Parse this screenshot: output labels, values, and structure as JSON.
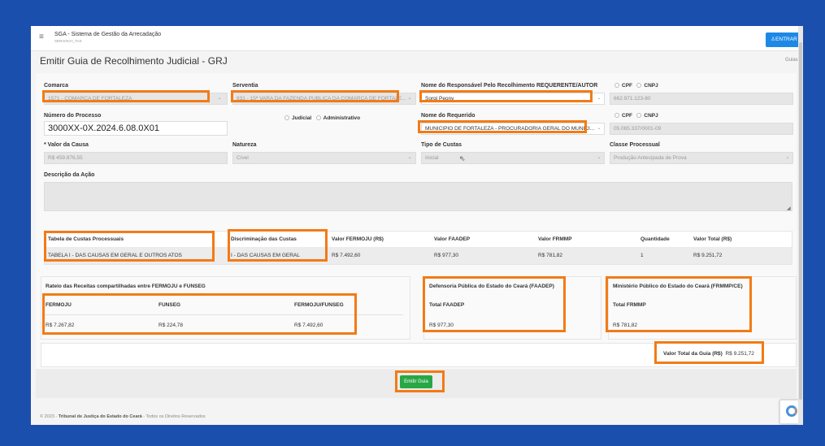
{
  "header": {
    "app_title": "SGA - Sistema de Gestão da Arrecadação",
    "app_subtitle": "SERAVICH_TAS",
    "login_label": "ENTRAR",
    "page_title": "Emitir Guia de Recolhimento Judicial - GRJ",
    "breadcrumb": "Guias"
  },
  "form": {
    "comarca": {
      "label": "Comarca",
      "value": "1571 - COMARCA DE FORTALEZA"
    },
    "serventia": {
      "label": "Serventia",
      "value": "831 - 15ª VARA DA FAZENDA PUBLICA DA COMARCA DE FORTALE..."
    },
    "responsavel": {
      "label": "Nome do Responsável Pelo Recolhimento REQUERENTE/AUTOR",
      "value": "Sorgi Peony"
    },
    "doc_type1": {
      "cpf": "CPF",
      "cnpj": "CNPJ",
      "value": "662.971.123-80"
    },
    "numero_processo": {
      "label": "Número do Processo",
      "value": "3000XX-0X.2024.6.08.0X01"
    },
    "tipo_processo": {
      "judicial": "Judicial",
      "administrativo": "Administrativo"
    },
    "requerido": {
      "label": "Nome do Requerido",
      "value": "MUNICIPIO DE FORTALEZA - PROCURADORIA GERAL DO MUNICI..."
    },
    "doc_type2": {
      "cpf": "CPF",
      "cnpj": "CNPJ",
      "value": "05.065.337/0001-09"
    },
    "valor_causa": {
      "label": "* Valor da Causa",
      "value": "R$ 459.876,55"
    },
    "natureza": {
      "label": "Natureza",
      "value": "Cível"
    },
    "tipo_custas": {
      "label": "Tipo de Custas",
      "value": "Inicial"
    },
    "classe_processual": {
      "label": "Classe Processual",
      "value": "Produção Antecipada de Prova"
    },
    "descricao": {
      "label": "Descrição da Ação",
      "value": ""
    }
  },
  "custas_table": {
    "headers": [
      "Tabela de Custas Processuais",
      "Discriminação das Custas",
      "Valor FERMOJU (R$)",
      "Valor FAADEP",
      "Valor FRMMP",
      "Quantidade",
      "Valor Total (R$)"
    ],
    "row": [
      "TABELA I - DAS CAUSAS EM GERAL E OUTROS ATOS",
      "I - DAS CAUSAS EM GERAL",
      "R$ 7.492,60",
      "R$ 977,30",
      "R$ 781,82",
      "1",
      "R$ 9.251,72"
    ]
  },
  "rateio": {
    "title": "Rateio das Receitas compartilhadas entre FERMOJU e FUNSEG",
    "headers": [
      "FERMOJU",
      "FUNSEG",
      "FERMOJU/FUNSEG"
    ],
    "values": [
      "R$ 7.267,82",
      "R$ 224,78",
      "R$ 7.492,60"
    ]
  },
  "faadep": {
    "title": "Defensoria Pública do Estado do Ceará (FAADEP)",
    "label": "Total FAADEP",
    "value": "R$ 977,30"
  },
  "frmmp": {
    "title": "Ministério Público do Estado do Ceará (FRMMP/CE)",
    "label": "Total FRMMP",
    "value": "R$ 781,82"
  },
  "total": {
    "label": "Valor Total da Guia (R$)",
    "value": "R$ 9.251,72"
  },
  "actions": {
    "emit_label": "Emitir Guia"
  },
  "footer": {
    "year": "© 2023 -",
    "org": "Tribunal de Justiça do Estado do Ceará",
    "rights": "- Todos os Direitos Reservados"
  },
  "colors": {
    "background": "#1b4fae",
    "highlight": "#f27b16",
    "primary": "#1e88e5",
    "success": "#28a745"
  }
}
